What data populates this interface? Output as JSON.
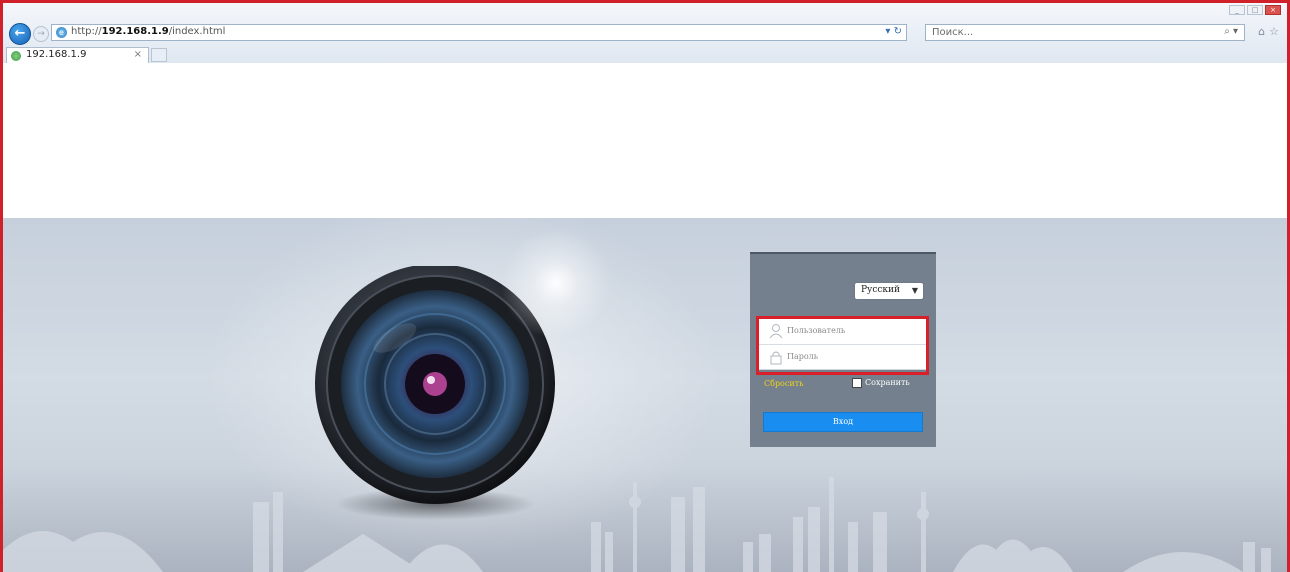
{
  "browser": {
    "address": {
      "url_prefix": "http://",
      "url_host": "192.168.1.9",
      "url_path": "/index.html",
      "refresh_symbol": "▾ ↻"
    },
    "search": {
      "placeholder": "Поиск...",
      "button_symbol": "⌕ ▾"
    },
    "tab": {
      "title": "192.168.1.9",
      "close_symbol": "×"
    },
    "toolbar_icons": [
      "back-icon",
      "forward-icon",
      "home-icon",
      "star-icon"
    ],
    "window_controls": [
      "minimize",
      "maximize",
      "close"
    ]
  },
  "login": {
    "language_selected": "Русский",
    "username_placeholder": "Пользователь",
    "password_placeholder": "Пароль",
    "clear_label": "Сбросить",
    "remember_label": "Сохранить",
    "login_button": "Вход"
  },
  "colors": {
    "highlight_red": "#d9202a",
    "login_button": "#1a8ef0",
    "clear_link": "#f2d21c",
    "panel_bg": "#74808e"
  }
}
